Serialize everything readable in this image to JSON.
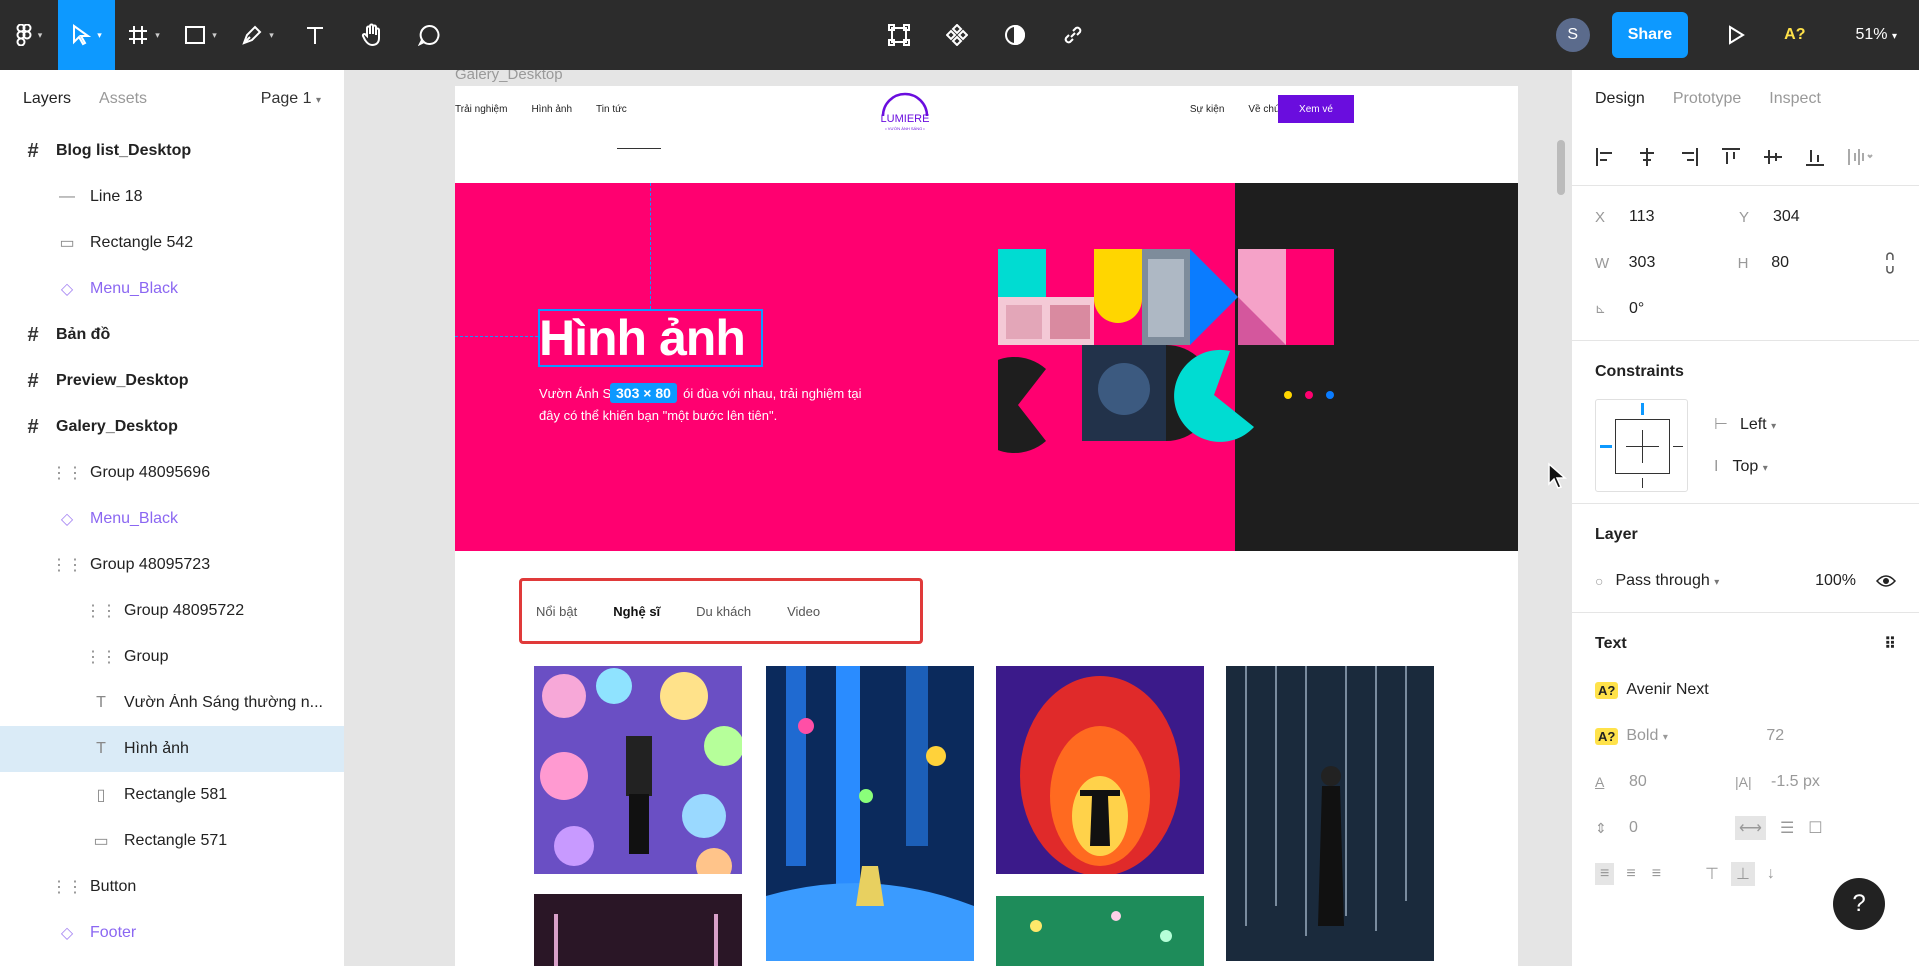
{
  "toolbar": {
    "avatar_initial": "S",
    "share_label": "Share",
    "ax_badge": "A?",
    "zoom_label": "51%"
  },
  "layers_panel": {
    "tabs": [
      "Layers",
      "Assets"
    ],
    "page_label": "Page 1",
    "items": [
      {
        "label": "Blog list_Desktop",
        "type": "frame",
        "indent": 0
      },
      {
        "label": "Line 18",
        "type": "line",
        "indent": 1
      },
      {
        "label": "Rectangle 542",
        "type": "rect",
        "indent": 1
      },
      {
        "label": "Menu_Black",
        "type": "component",
        "indent": 1
      },
      {
        "label": "Bản đồ",
        "type": "frame",
        "indent": 0
      },
      {
        "label": "Preview_Desktop",
        "type": "frame",
        "indent": 0
      },
      {
        "label": "Galery_Desktop",
        "type": "frame",
        "indent": 0
      },
      {
        "label": "Group 48095696",
        "type": "group",
        "indent": 1
      },
      {
        "label": "Menu_Black",
        "type": "component",
        "indent": 1
      },
      {
        "label": "Group 48095723",
        "type": "group",
        "indent": 1
      },
      {
        "label": "Group 48095722",
        "type": "group",
        "indent": 2
      },
      {
        "label": "Group",
        "type": "group",
        "indent": 2
      },
      {
        "label": "Vườn Ánh Sáng thường n...",
        "type": "text",
        "indent": 2
      },
      {
        "label": "Hình ảnh",
        "type": "text",
        "indent": 2,
        "selected": true
      },
      {
        "label": "Rectangle 581",
        "type": "rect-v",
        "indent": 2
      },
      {
        "label": "Rectangle 571",
        "type": "rect",
        "indent": 2
      },
      {
        "label": "Button",
        "type": "group",
        "indent": 1
      },
      {
        "label": "Footer",
        "type": "component",
        "indent": 1
      }
    ]
  },
  "canvas": {
    "frame_label": "Galery_Desktop",
    "nav_left": [
      "Trải nghiệm",
      "Hình ảnh",
      "Tin tức"
    ],
    "nav_right": [
      "Sự kiện",
      "Về chúng tôi"
    ],
    "nav_cta": "Xem vé",
    "logo_text": "LUMIERE",
    "logo_sub": "• VƯỜN ÁNH SÁNG •",
    "hero_title": "Hình ảnh",
    "hero_sub_a": "Vườn Ánh S",
    "hero_sub_b": "ói đùa với nhau, trải nghiệm tại đây có thể khiến bạn \"một bước lên tiên\".",
    "dimension_badge": "303 × 80",
    "gallery_tabs": [
      "Nổi bật",
      "Nghệ sĩ",
      "Du khách",
      "Video"
    ],
    "active_tab": "Nghệ sĩ",
    "colors": {
      "hero_pink": "#ff0070",
      "cyan": "#00dcd2",
      "yellow": "#ffd600",
      "blue": "#0a7cff",
      "dark": "#1e1e1e",
      "cta_purple": "#6a0dde"
    }
  },
  "design_panel": {
    "tabs": [
      "Design",
      "Prototype",
      "Inspect"
    ],
    "x_label": "X",
    "x_value": "113",
    "y_label": "Y",
    "y_value": "304",
    "w_label": "W",
    "w_value": "303",
    "h_label": "H",
    "h_value": "80",
    "rotation": "0°",
    "constraints_title": "Constraints",
    "constraint_h": "Left",
    "constraint_v": "Top",
    "layer_title": "Layer",
    "blend_mode": "Pass through",
    "opacity": "100%",
    "text_title": "Text",
    "font_family": "Avenir Next",
    "font_weight": "Bold",
    "font_size": "72",
    "line_height": "80",
    "letter_spacing": "-1.5 px",
    "paragraph_spacing": "0",
    "help_label": "?"
  }
}
